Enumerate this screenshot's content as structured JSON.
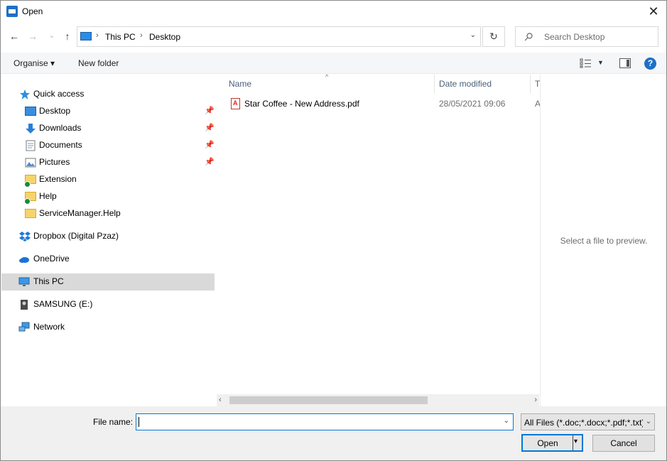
{
  "window": {
    "title": "Open",
    "close_glyph": "✕"
  },
  "nav": {
    "back_glyph": "←",
    "forward_glyph": "→",
    "recent_glyph": "⌄",
    "up_glyph": "↑"
  },
  "address": {
    "breadcrumbs": [
      "This PC",
      "Desktop"
    ],
    "separator": "›",
    "dropdown_glyph": "⌄",
    "refresh_glyph": "↻"
  },
  "search": {
    "placeholder": "Search Desktop"
  },
  "toolbar": {
    "organise_label": "Organise ▾",
    "new_folder_label": "New folder",
    "help_label": "?"
  },
  "sidebar": {
    "items": [
      {
        "label": "Quick access",
        "icon": "star-icon"
      },
      {
        "label": "Desktop",
        "icon": "desktop-folder-icon",
        "pinned": true
      },
      {
        "label": "Downloads",
        "icon": "download-icon",
        "pinned": true
      },
      {
        "label": "Documents",
        "icon": "documents-icon",
        "pinned": true
      },
      {
        "label": "Pictures",
        "icon": "pictures-icon",
        "pinned": true
      },
      {
        "label": "Extension",
        "icon": "folder-icon"
      },
      {
        "label": "Help",
        "icon": "folder-icon"
      },
      {
        "label": "ServiceManager.Help",
        "icon": "folder-icon"
      },
      {
        "label": "Dropbox (Digital Pzaz)",
        "icon": "dropbox-icon"
      },
      {
        "label": "OneDrive",
        "icon": "cloud-icon"
      },
      {
        "label": "This PC",
        "icon": "computer-icon",
        "selected": true
      },
      {
        "label": "SAMSUNG (E:)",
        "icon": "drive-icon"
      },
      {
        "label": "Network",
        "icon": "network-icon"
      }
    ]
  },
  "file_list": {
    "columns": [
      "Name",
      "Date modified",
      "T"
    ],
    "sort_glyph": "^",
    "rows": [
      {
        "name": "Star Coffee - New Address.pdf",
        "date_modified": "28/05/2021 09:06",
        "type": "A"
      }
    ],
    "scroll_left": "‹",
    "scroll_right": "›"
  },
  "preview": {
    "text": "Select a file to preview."
  },
  "footer": {
    "file_name_label": "File name:",
    "file_name_value": "",
    "input_dropdown_glyph": "⌄",
    "filter_value": "All Files (*.doc;*.docx;*.pdf;*.txt)",
    "filter_dropdown_glyph": "⌄",
    "open_label": "Open",
    "open_dropdown_glyph": "▾",
    "cancel_label": "Cancel"
  },
  "colors": {
    "accent": "#0078d7",
    "selection": "#d9d9d9",
    "header_text": "#4c607a"
  }
}
